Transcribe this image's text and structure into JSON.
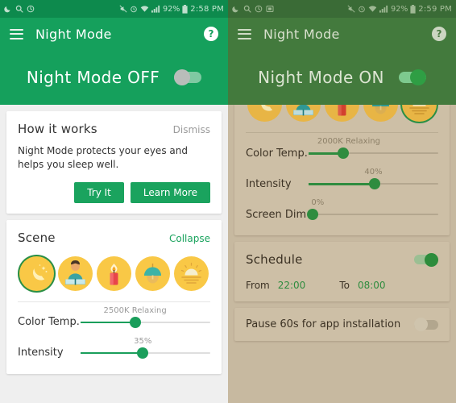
{
  "left": {
    "status_bar": {
      "icons": [
        "night-mode-moon-icon",
        "search-icon",
        "clock-badge-icon"
      ],
      "right_icons": [
        "mute-icon",
        "alarm-icon",
        "wifi-icon",
        "signal-icon"
      ],
      "battery": "92%",
      "time": "2:58 PM"
    },
    "app_bar": {
      "title": "Night Mode",
      "menu": "menu-icon",
      "help": "?"
    },
    "hero": {
      "label": "Night Mode OFF",
      "toggle_on": false
    },
    "how_it_works": {
      "title": "How it works",
      "dismiss": "Dismiss",
      "description": "Night Mode protects your eyes and helps you sleep well.",
      "primary_button": "Try It",
      "secondary_button": "Learn More"
    },
    "scene": {
      "title": "Scene",
      "collapse": "Collapse",
      "items": [
        {
          "name": "moon-stars-scene",
          "selected": true
        },
        {
          "name": "reading-scene",
          "selected": false
        },
        {
          "name": "candle-scene",
          "selected": false
        },
        {
          "name": "lamp-scene",
          "selected": false
        },
        {
          "name": "sunset-scene",
          "selected": false
        }
      ]
    },
    "sliders": [
      {
        "label": "Color Temp.",
        "value": "2500K Relaxing",
        "pct": 42
      },
      {
        "label": "Intensity",
        "value": "35%",
        "pct": 48
      }
    ]
  },
  "right": {
    "status_bar": {
      "icons": [
        "night-mode-moon-icon",
        "search-icon",
        "clock-badge-icon",
        "sdcard-icon"
      ],
      "right_icons": [
        "mute-icon",
        "alarm-icon",
        "wifi-icon",
        "signal-icon"
      ],
      "battery": "92%",
      "time": "2:59 PM"
    },
    "app_bar": {
      "title": "Night Mode",
      "menu": "menu-icon",
      "help": "?"
    },
    "hero": {
      "label": "Night Mode  ON",
      "toggle_on": true
    },
    "scene": {
      "items": [
        {
          "name": "moon-stars-scene",
          "selected": false
        },
        {
          "name": "reading-scene",
          "selected": false
        },
        {
          "name": "candle-scene",
          "selected": false
        },
        {
          "name": "lamp-scene",
          "selected": false
        },
        {
          "name": "sunset-scene",
          "selected": true
        }
      ]
    },
    "sliders": [
      {
        "label": "Color Temp.",
        "value": "2000K Relaxing",
        "pct": 27
      },
      {
        "label": "Intensity",
        "value": "40%",
        "pct": 51
      },
      {
        "label": "Screen Dim",
        "value": "0%",
        "pct": 3
      }
    ],
    "schedule": {
      "title": "Schedule",
      "enabled": true,
      "from_label": "From",
      "from_value": "22:00",
      "to_label": "To",
      "to_value": "08:00"
    },
    "pause": {
      "label": "Pause 60s for app installation",
      "enabled": false
    }
  },
  "colors": {
    "accent_green": "#1aa35e",
    "night_green": "#437a3d",
    "sepia_card": "#cdbfa6",
    "scene_yellow": "#f9c846"
  }
}
